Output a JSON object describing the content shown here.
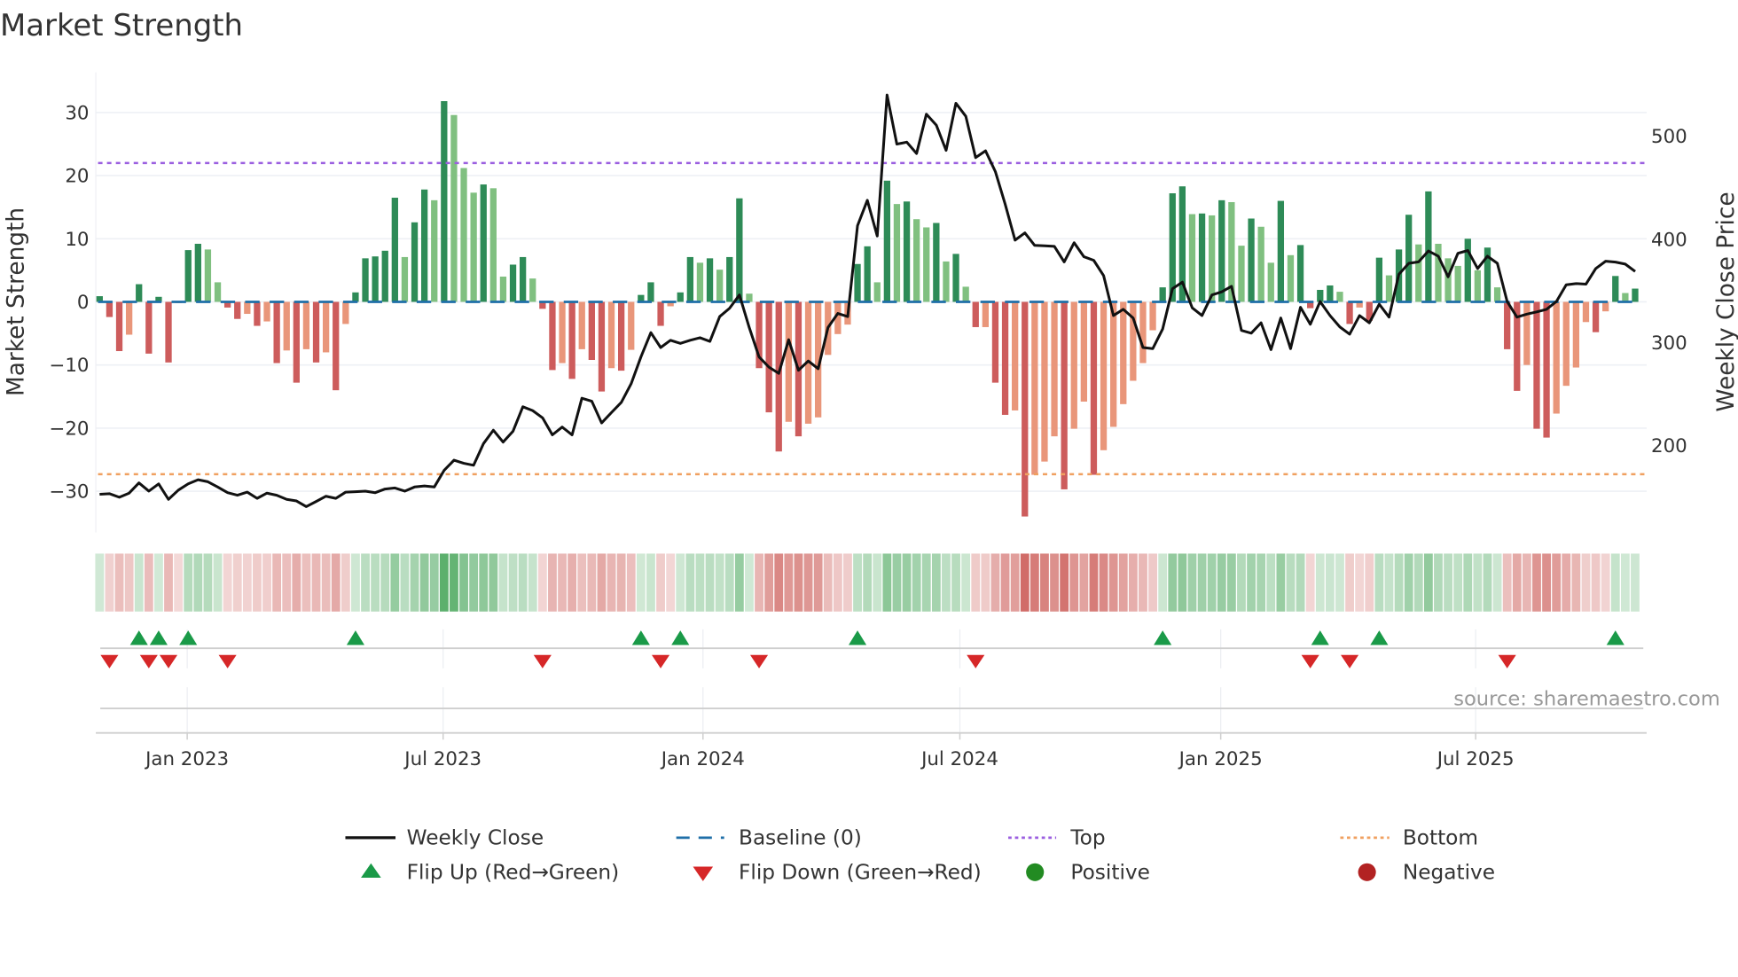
{
  "chart_data": {
    "type": "bar",
    "title": "Market Strength",
    "ylabel": "Market Strength",
    "ylabel_right": "Weekly Close Price",
    "ylim": [
      -36,
      36
    ],
    "ylim_right": [
      123,
      553
    ],
    "yticks": [
      "30",
      "20",
      "10",
      "0",
      "−10",
      "−20",
      "−30"
    ],
    "ytick_values": [
      30,
      20,
      10,
      0,
      -10,
      -20,
      -30
    ],
    "yticks_right": [
      "500",
      "400",
      "300",
      "200"
    ],
    "ytick_values_right": [
      500,
      400,
      300,
      200
    ],
    "xticks": [
      "Jan 2023",
      "Jul 2023",
      "Jan 2024",
      "Jul 2024",
      "Jan 2025",
      "Jul 2025"
    ],
    "xtick_week_index": [
      8.9,
      34.9,
      61.3,
      87.4,
      113.9,
      139.8
    ],
    "top_level": 22,
    "bottom_level": -27.3,
    "baseline": 0,
    "strength": [
      0.9,
      -2.4,
      -7.8,
      -5.2,
      2.8,
      -8.2,
      0.8,
      -9.6,
      -0.2,
      8.2,
      9.2,
      8.3,
      3.1,
      -0.9,
      -2.7,
      -1.9,
      -3.8,
      -3.1,
      -9.7,
      -7.7,
      -12.8,
      -7.5,
      -9.6,
      -8.0,
      -14.0,
      -3.5,
      1.5,
      6.9,
      7.2,
      8.1,
      16.5,
      7.1,
      12.6,
      17.8,
      16.1,
      31.8,
      29.6,
      21.2,
      17.3,
      18.6,
      18.0,
      4.0,
      5.9,
      7.1,
      3.7,
      -1.1,
      -10.8,
      -9.7,
      -12.2,
      -7.5,
      -9.2,
      -14.2,
      -10.5,
      -10.9,
      -7.6,
      1.1,
      3.1,
      -3.8,
      -0.7,
      1.5,
      7.1,
      6.2,
      6.9,
      5.1,
      7.1,
      16.4,
      1.3,
      -10.5,
      -17.5,
      -23.7,
      -19.0,
      -21.3,
      -19.3,
      -18.3,
      -8.4,
      -5.1,
      -3.6,
      6.0,
      8.8,
      3.1,
      19.2,
      15.5,
      15.9,
      13.1,
      11.8,
      12.5,
      6.4,
      7.6,
      2.4,
      -4.0,
      -4.0,
      -12.8,
      -17.9,
      -17.2,
      -34.0,
      -27.4,
      -25.3,
      -21.3,
      -29.7,
      -20.1,
      -15.8,
      -27.4,
      -23.5,
      -19.8,
      -16.2,
      -12.5,
      -9.7,
      -4.5,
      2.3,
      17.2,
      18.3,
      13.9,
      14.0,
      13.7,
      16.1,
      15.8,
      8.9,
      13.2,
      11.9,
      6.2,
      16.0,
      7.4,
      9.0,
      -1.0,
      1.9,
      2.6,
      1.6,
      -3.5,
      -0.9,
      -3.0,
      7.0,
      4.2,
      8.3,
      13.8,
      9.1,
      17.5,
      9.2,
      6.9,
      5.7,
      10.0,
      5.0,
      8.6,
      2.3,
      -7.5,
      -14.1,
      -10.0,
      -20.1,
      -21.5,
      -17.7,
      -13.3,
      -10.4,
      -3.2,
      -4.8,
      -1.5,
      4.1,
      1.4,
      2.1
    ],
    "strengthening": [
      1,
      1,
      1,
      0,
      1,
      1,
      1,
      1,
      0,
      1,
      1,
      0,
      0,
      1,
      1,
      0,
      1,
      0,
      1,
      0,
      1,
      0,
      1,
      0,
      1,
      0,
      1,
      1,
      1,
      1,
      1,
      0,
      1,
      1,
      0,
      1,
      0,
      0,
      0,
      1,
      0,
      0,
      1,
      1,
      0,
      1,
      1,
      0,
      1,
      0,
      1,
      1,
      0,
      1,
      0,
      1,
      1,
      1,
      0,
      1,
      1,
      0,
      1,
      0,
      1,
      1,
      0,
      1,
      1,
      1,
      0,
      1,
      0,
      0,
      0,
      0,
      0,
      1,
      1,
      0,
      1,
      0,
      1,
      0,
      0,
      1,
      0,
      1,
      0,
      1,
      0,
      1,
      1,
      0,
      1,
      0,
      0,
      0,
      1,
      0,
      0,
      1,
      0,
      0,
      0,
      0,
      0,
      0,
      1,
      1,
      1,
      0,
      1,
      0,
      1,
      0,
      0,
      1,
      0,
      0,
      1,
      0,
      1,
      1,
      1,
      1,
      0,
      1,
      0,
      1,
      1,
      0,
      1,
      1,
      0,
      1,
      0,
      0,
      0,
      1,
      0,
      1,
      0,
      1,
      1,
      0,
      1,
      1,
      0,
      0,
      0,
      0,
      1,
      0,
      1,
      0,
      1
    ],
    "weekly_close": [
      153,
      153.5,
      150,
      154,
      164,
      156,
      163,
      148,
      157,
      163,
      167,
      165,
      160,
      154.5,
      152,
      155,
      149,
      154,
      152,
      148,
      146.5,
      141,
      146,
      151,
      149,
      155,
      155.5,
      156,
      154.5,
      158,
      159,
      156,
      160,
      161,
      160,
      176,
      186,
      183,
      181,
      202,
      215,
      203.5,
      214,
      237.6,
      234,
      227,
      210.5,
      218,
      210.5,
      246,
      243,
      222,
      232,
      242,
      260,
      286,
      309.5,
      295,
      302,
      299,
      302,
      304.5,
      301,
      325,
      333,
      346,
      314.5,
      286,
      276,
      270,
      302.6,
      273,
      282,
      274.5,
      314.5,
      328,
      325,
      413,
      437.6,
      403,
      539.6,
      492,
      494,
      483,
      521,
      510.5,
      486,
      531.6,
      519,
      479,
      485.5,
      465.5,
      434,
      399,
      406,
      394,
      393.5,
      393,
      378,
      396.6,
      383,
      379.5,
      364.6,
      326,
      332,
      323.6,
      295,
      294,
      313,
      352,
      358.4,
      333.6,
      326,
      346,
      349,
      354.4,
      311.7,
      309,
      319,
      293,
      323.6,
      294,
      334,
      317.6,
      339.6,
      326,
      315,
      308,
      326,
      319,
      337,
      324.5,
      366,
      376.6,
      378,
      388.6,
      383.5,
      363.5,
      386.3,
      389,
      371.5,
      383.5,
      376.6,
      339.6,
      324.5,
      327.4,
      329.6,
      332,
      339.6,
      355.8,
      357,
      356.4,
      371.5,
      378.6,
      377.8,
      375.8,
      368.7
    ],
    "flip_up_week_index": [
      4,
      6,
      9,
      26,
      55,
      59,
      77,
      108,
      124,
      130,
      154
    ],
    "flip_down_week_index": [
      1,
      5,
      7,
      13,
      45,
      57,
      67,
      89,
      123,
      127,
      143
    ],
    "legend": {
      "placement": "bottom",
      "items": [
        "Weekly Close",
        "Baseline (0)",
        "Top",
        "Bottom",
        "Flip Up (Red→Green)",
        "Flip Down (Green→Red)",
        "Positive",
        "Negative"
      ]
    },
    "source": "source: sharemaestro.com"
  },
  "colors": {
    "strong_positive": "#2e8b57",
    "weak_positive": "#80c080",
    "strong_negative": "#cd5c5c",
    "weak_negative": "#e9967a",
    "line": "#111111",
    "baseline": "#1f6fa8",
    "top": "#9b5fe0",
    "bottom": "#f0a060",
    "flip_up": "#1a9a48",
    "flip_down": "#d62728",
    "positive": "#228b22",
    "negative": "#b22222"
  }
}
